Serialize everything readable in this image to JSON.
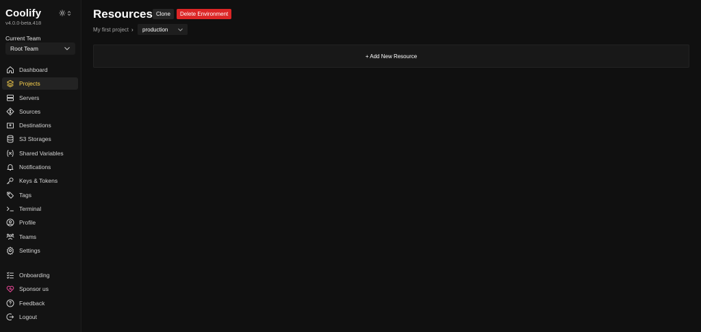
{
  "app": {
    "name": "Coolify",
    "version": "v4.0.0-beta.418"
  },
  "team": {
    "label": "Current Team",
    "selected": "Root Team"
  },
  "nav": [
    {
      "label": "Dashboard",
      "icon": "home-icon"
    },
    {
      "label": "Projects",
      "icon": "layers-icon",
      "active": true
    },
    {
      "label": "Servers",
      "icon": "server-icon"
    },
    {
      "label": "Sources",
      "icon": "git-icon"
    },
    {
      "label": "Destinations",
      "icon": "destination-icon"
    },
    {
      "label": "S3 Storages",
      "icon": "database-icon"
    },
    {
      "label": "Shared Variables",
      "icon": "variable-icon"
    },
    {
      "label": "Notifications",
      "icon": "bell-icon"
    },
    {
      "label": "Keys & Tokens",
      "icon": "key-icon"
    },
    {
      "label": "Tags",
      "icon": "tag-icon"
    },
    {
      "label": "Terminal",
      "icon": "terminal-icon"
    },
    {
      "label": "Profile",
      "icon": "user-icon"
    },
    {
      "label": "Teams",
      "icon": "users-icon"
    },
    {
      "label": "Settings",
      "icon": "gear-icon"
    }
  ],
  "nav_bottom": [
    {
      "label": "Onboarding",
      "icon": "checklist-icon"
    },
    {
      "label": "Sponsor us",
      "icon": "heart-icon"
    },
    {
      "label": "Feedback",
      "icon": "help-icon"
    },
    {
      "label": "Logout",
      "icon": "logout-icon"
    }
  ],
  "page": {
    "title": "Resources",
    "clone_label": "Clone",
    "delete_label": "Delete Environment",
    "breadcrumb_project": "My first project",
    "breadcrumb_sep": "›",
    "environment": "production",
    "add_resource_label": "+ Add New Resource"
  },
  "colors": {
    "accent": "#fcd34d",
    "danger": "#dc2626",
    "sponsor": "#ec4899",
    "background": "#101010"
  }
}
